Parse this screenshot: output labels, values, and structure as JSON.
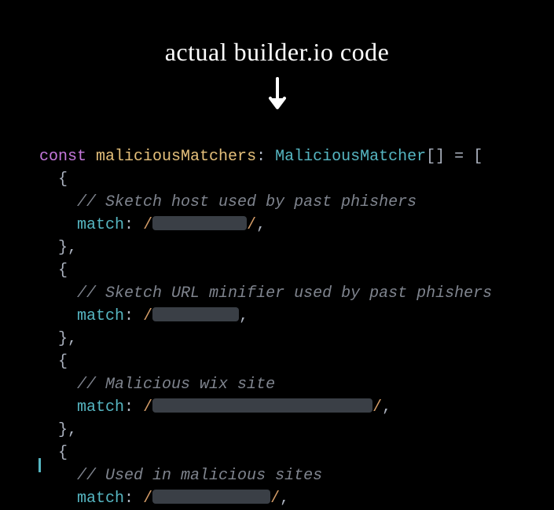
{
  "annotation": {
    "text": "actual builder.io code"
  },
  "code": {
    "keyword_const": "const",
    "var_name": "maliciousMatchers",
    "colon": ":",
    "type_name": "MaliciousMatcher",
    "brackets": "[]",
    "equals": "=",
    "open_array": "[",
    "open_brace": "{",
    "close_brace": "},",
    "comment_prefix": "// ",
    "prop_match": "match",
    "prop_colon": ":",
    "regex_slash": "/",
    "comma": ",",
    "entries": [
      {
        "comment": "Sketch host used by past phishers",
        "redact_width": 120
      },
      {
        "comment": "Sketch URL minifier used by past phishers",
        "redact_width": 110
      },
      {
        "comment": "Malicious wix site",
        "redact_width": 280
      },
      {
        "comment": "Used in malicious sites",
        "redact_width": 150
      }
    ]
  }
}
